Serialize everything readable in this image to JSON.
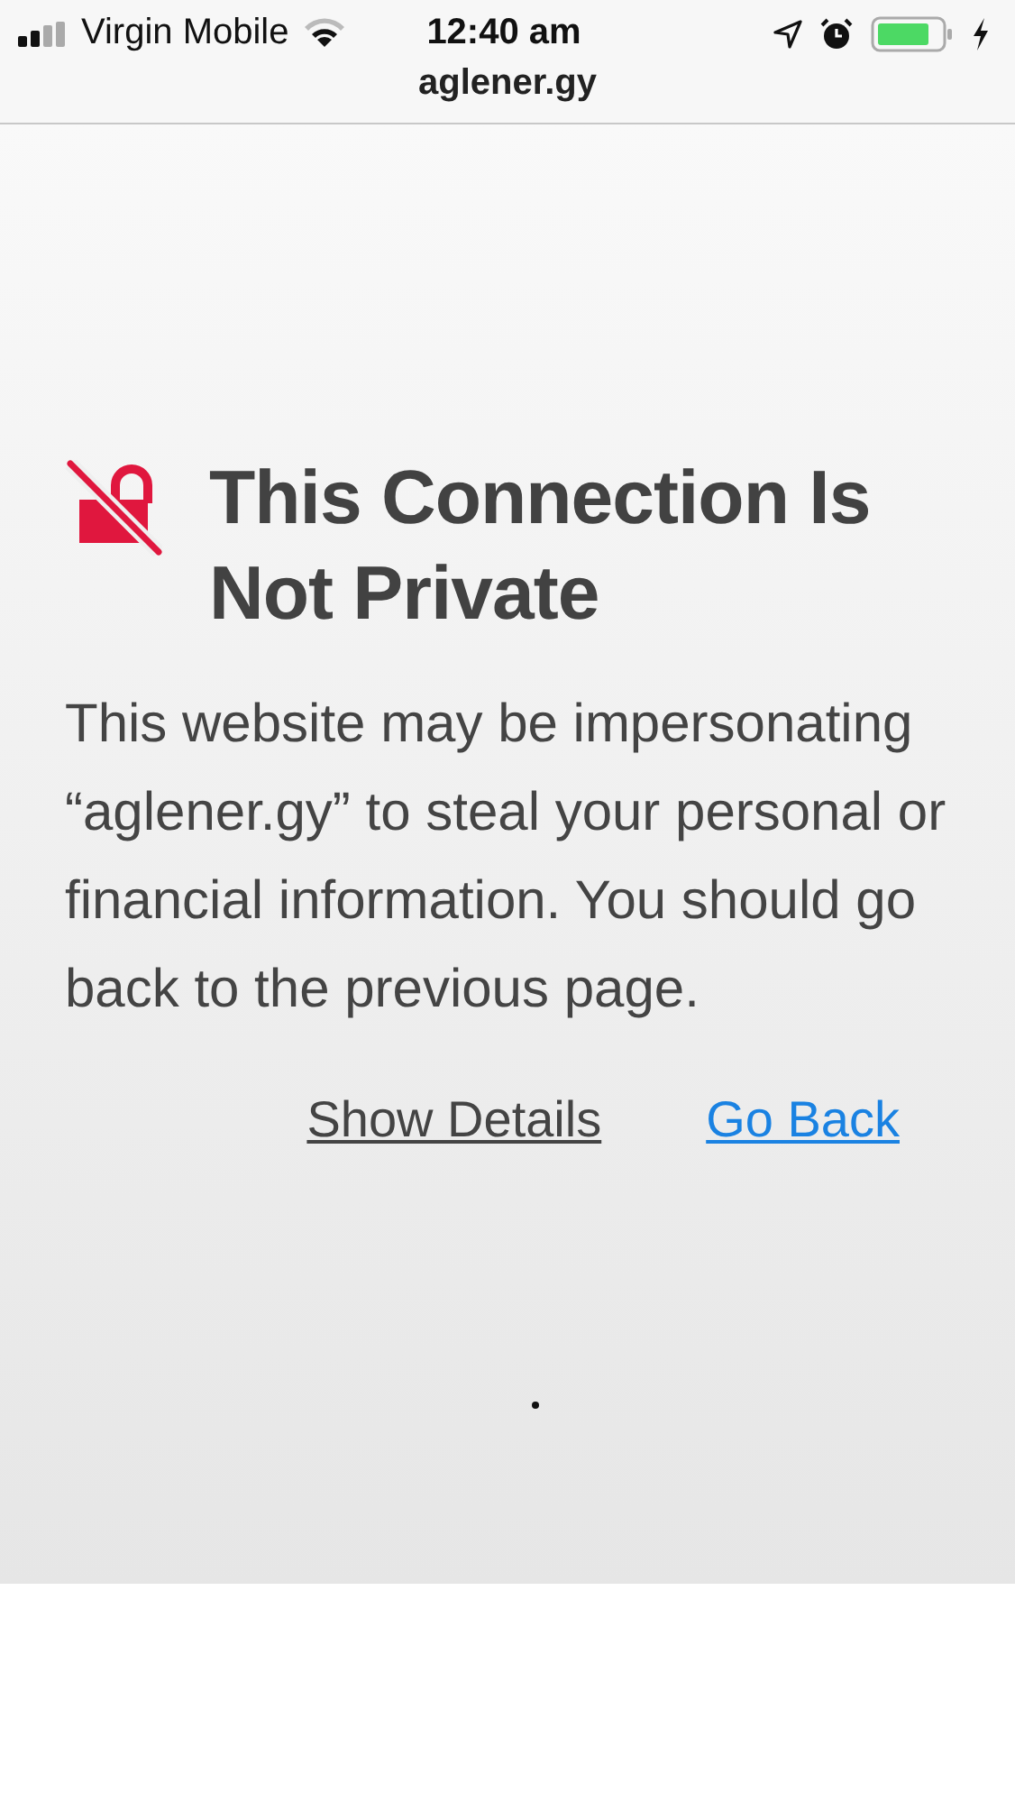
{
  "status_bar": {
    "carrier": "Virgin Mobile",
    "time": "12:40 am"
  },
  "address_bar": {
    "url": "aglener.gy"
  },
  "warning": {
    "title": "This Connection Is Not Private",
    "message": "This website may be impersonating “aglener.gy” to steal your personal or financial information. You should go back to the previous page."
  },
  "links": [
    {
      "label": "Show Details",
      "kind": "secondary"
    },
    {
      "label": "Go Back",
      "kind": "primary"
    }
  ]
}
